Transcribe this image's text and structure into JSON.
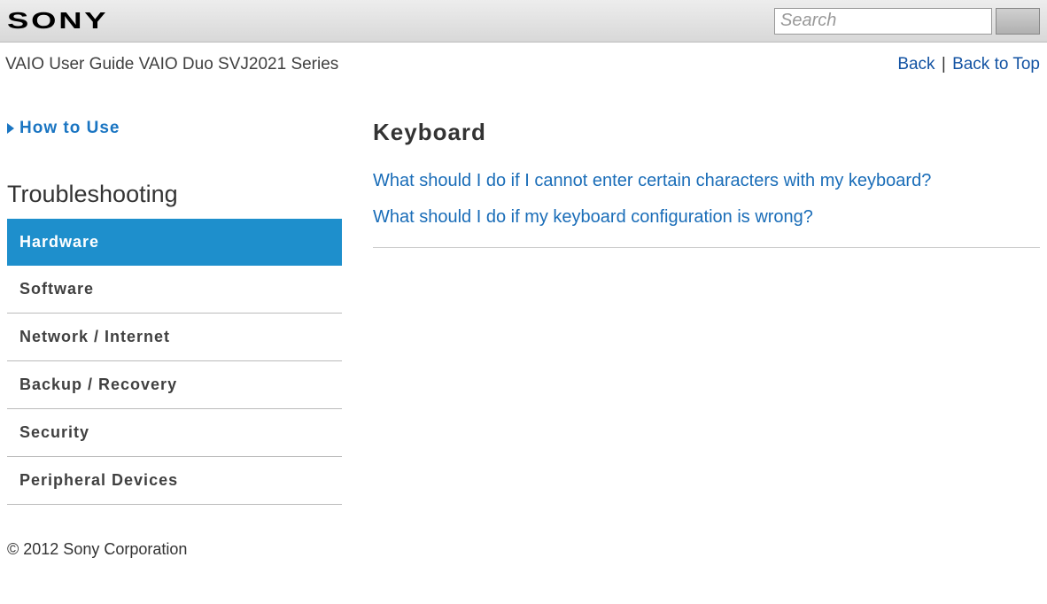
{
  "header": {
    "logo": "SONY",
    "search_placeholder": "Search"
  },
  "subheader": {
    "breadcrumb": "VAIO User Guide VAIO Duo SVJ2021 Series",
    "back": "Back",
    "back_to_top": "Back to Top"
  },
  "sidebar": {
    "how_to_use": "How to Use",
    "troubleshooting_title": "Troubleshooting",
    "items": [
      {
        "label": "Hardware",
        "active": true
      },
      {
        "label": "Software",
        "active": false
      },
      {
        "label": "Network / Internet",
        "active": false
      },
      {
        "label": "Backup / Recovery",
        "active": false
      },
      {
        "label": "Security",
        "active": false
      },
      {
        "label": "Peripheral Devices",
        "active": false
      }
    ]
  },
  "main": {
    "heading": "Keyboard",
    "faqs": [
      "What should I do if I cannot enter certain characters with my keyboard?",
      "What should I do if my keyboard configuration is wrong?"
    ]
  },
  "footer": {
    "copyright": "© 2012 Sony Corporation"
  }
}
